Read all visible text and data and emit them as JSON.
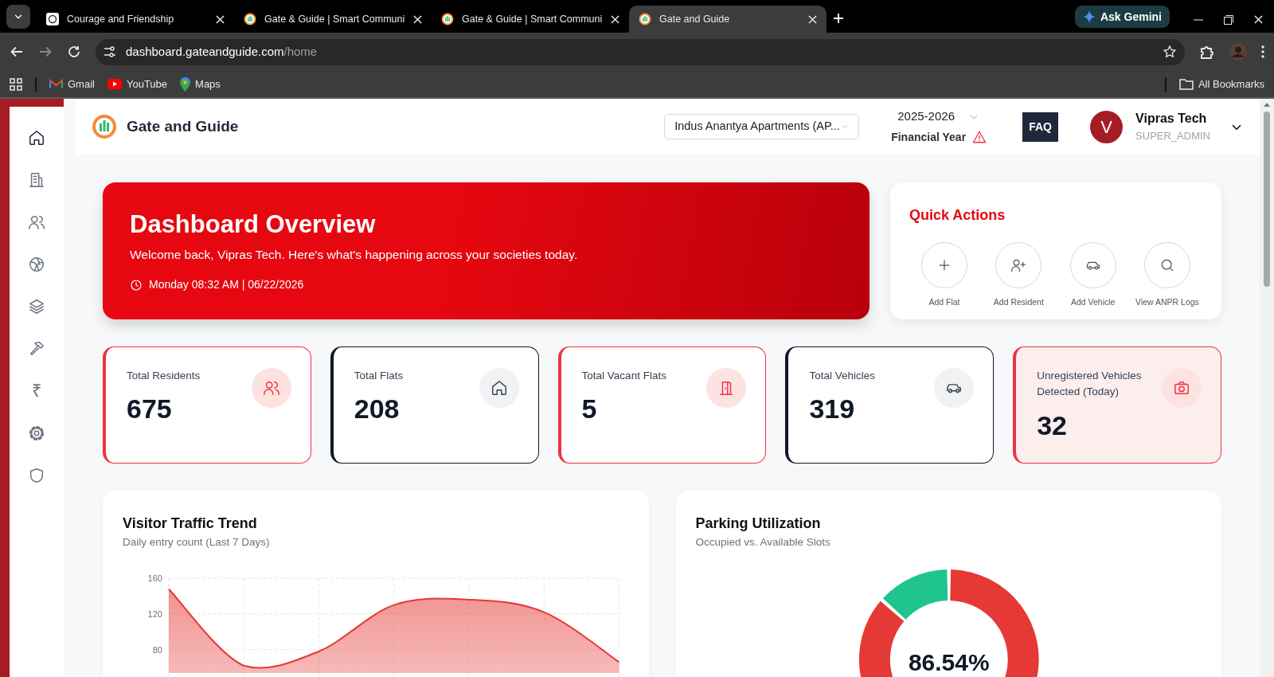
{
  "browser": {
    "tabs": [
      {
        "kind": "chat",
        "title": "Courage and Friendship",
        "selected": false
      },
      {
        "kind": "site",
        "title": "Gate & Guide | Smart Communi",
        "selected": false
      },
      {
        "kind": "site",
        "title": "Gate & Guide | Smart Communi",
        "selected": false
      },
      {
        "kind": "site",
        "title": "Gate and Guide",
        "selected": true
      }
    ],
    "gemini_button": "Ask Gemini",
    "url": {
      "host": "dashboard.gateandguide.com",
      "path": "/home"
    },
    "bookmarks": [
      {
        "kind": "mail",
        "label": "Gmail"
      },
      {
        "kind": "video",
        "label": "YouTube"
      },
      {
        "kind": "pin",
        "label": "Maps"
      }
    ],
    "all_bookmarks": "All Bookmarks"
  },
  "sidebar": {
    "items": [
      {
        "kind": "home",
        "selected": true
      },
      {
        "kind": "building",
        "selected": false
      },
      {
        "kind": "users",
        "selected": false
      },
      {
        "kind": "ball",
        "selected": false
      },
      {
        "kind": "layers",
        "selected": false
      },
      {
        "kind": "hammer",
        "selected": false
      },
      {
        "kind": "rupee",
        "symbol": "₹",
        "selected": false
      },
      {
        "kind": "gear",
        "selected": false
      },
      {
        "kind": "shield",
        "selected": false
      }
    ]
  },
  "header": {
    "brand": "Gate and Guide",
    "society_select": "Indus Anantya Apartments (AP...",
    "year": "2025-2026",
    "year_label": "Financial Year",
    "year_warning": true,
    "faq": "FAQ",
    "user": {
      "initial": "V",
      "name": "Vipras Tech",
      "role": "SUPER_ADMIN"
    }
  },
  "hero": {
    "title": "Dashboard Overview",
    "subtitle": "Welcome back, Vipras Tech. Here's what's happening across your societies today.",
    "datetime": "Monday 08:32 AM | 06/22/2026"
  },
  "quick_actions": {
    "title": "Quick Actions",
    "items": [
      {
        "kind": "plus",
        "label": "Add Flat"
      },
      {
        "kind": "user-plus",
        "label": "Add Resident"
      },
      {
        "kind": "car",
        "label": "Add Vehicle"
      },
      {
        "kind": "search",
        "label": "View ANPR Logs"
      }
    ]
  },
  "stats": [
    {
      "kind": "users",
      "label": "Total Residents",
      "value": "675",
      "color": "#ef3340",
      "highlight": false
    },
    {
      "kind": "home",
      "label": "Total Flats",
      "value": "208",
      "color": "#111827",
      "highlight": false
    },
    {
      "kind": "door",
      "label": "Total Vacant Flats",
      "value": "5",
      "color": "#ef3340",
      "highlight": false
    },
    {
      "kind": "car",
      "label": "Total Vehicles",
      "value": "319",
      "color": "#111827",
      "highlight": false
    },
    {
      "kind": "camera",
      "label": "Unregistered Vehicles Detected (Today)",
      "value": "32",
      "color": "#ef3340",
      "highlight": true
    }
  ],
  "traffic": {
    "title": "Visitor Traffic Trend",
    "subtitle": "Daily entry count (Last 7 Days)",
    "chart_data": {
      "type": "area",
      "ylim": [
        0,
        160
      ],
      "yticks": [
        80,
        120,
        160
      ],
      "grid": true,
      "series": [
        {
          "color": "#e53935",
          "values": [
            148,
            62,
            78,
            130,
            136,
            122,
            66
          ]
        }
      ]
    }
  },
  "parking": {
    "title": "Parking Utilization",
    "subtitle": "Occupied vs. Available Slots",
    "center_label": "86.54%",
    "chart_data": {
      "type": "donut",
      "values": [
        86.54,
        13.46
      ],
      "colors": [
        "#e53935",
        "#20c58e"
      ]
    }
  }
}
